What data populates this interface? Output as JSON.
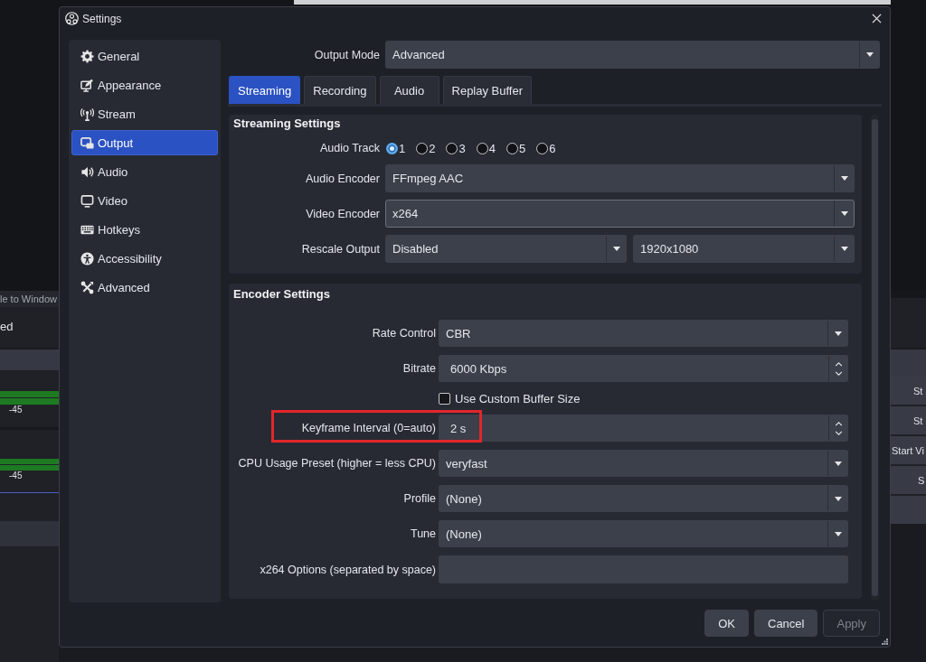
{
  "background_window": {
    "dock_title": "le to Window",
    "panel_text": "ed",
    "meter_labels": [
      "-45",
      "-45"
    ],
    "control_buttons": [
      "St",
      "St",
      "Start Vi",
      "S"
    ]
  },
  "dialog": {
    "title": "Settings",
    "sidebar": {
      "items": [
        {
          "label": "General",
          "selected": false
        },
        {
          "label": "Appearance",
          "selected": false
        },
        {
          "label": "Stream",
          "selected": false
        },
        {
          "label": "Output",
          "selected": true
        },
        {
          "label": "Audio",
          "selected": false
        },
        {
          "label": "Video",
          "selected": false
        },
        {
          "label": "Hotkeys",
          "selected": false
        },
        {
          "label": "Accessibility",
          "selected": false
        },
        {
          "label": "Advanced",
          "selected": false
        }
      ]
    },
    "output_mode": {
      "label": "Output Mode",
      "value": "Advanced"
    },
    "tabs": [
      {
        "label": "Streaming",
        "selected": true
      },
      {
        "label": "Recording",
        "selected": false
      },
      {
        "label": "Audio",
        "selected": false
      },
      {
        "label": "Replay Buffer",
        "selected": false
      }
    ],
    "streaming_settings": {
      "title": "Streaming Settings",
      "rows": [
        {
          "kind": "radios",
          "label": "Audio Track",
          "options": [
            {
              "label": "1",
              "selected": true
            },
            {
              "label": "2",
              "selected": false
            },
            {
              "label": "3",
              "selected": false
            },
            {
              "label": "4",
              "selected": false
            },
            {
              "label": "5",
              "selected": false
            },
            {
              "label": "6",
              "selected": false
            }
          ]
        },
        {
          "kind": "combo",
          "label": "Audio Encoder",
          "value": "FFmpeg AAC",
          "focused": false
        },
        {
          "kind": "combo",
          "label": "Video Encoder",
          "value": "x264",
          "focused": true
        },
        {
          "kind": "combo_pair",
          "label": "Rescale Output",
          "values": [
            "Disabled",
            "1920x1080"
          ],
          "focused": false
        }
      ]
    },
    "encoder_settings": {
      "title": "Encoder Settings",
      "rows": [
        {
          "kind": "combo",
          "label": "Rate Control",
          "value": "CBR",
          "highlighted": false
        },
        {
          "kind": "spin",
          "label": "Bitrate",
          "value": "6000 Kbps",
          "highlighted": false
        },
        {
          "kind": "checkbox",
          "label": "Use Custom Buffer Size",
          "checked": false,
          "highlighted": false
        },
        {
          "kind": "spin",
          "label": "Keyframe Interval (0=auto)",
          "value": "2 s",
          "highlighted": true
        },
        {
          "kind": "combo",
          "label": "CPU Usage Preset (higher = less CPU)",
          "value": "veryfast",
          "highlighted": false
        },
        {
          "kind": "combo",
          "label": "Profile",
          "value": "(None)",
          "highlighted": false
        },
        {
          "kind": "combo",
          "label": "Tune",
          "value": "(None)",
          "highlighted": false
        },
        {
          "kind": "text",
          "label": "x264 Options (separated by space)",
          "highlighted": false
        }
      ]
    },
    "buttons": [
      {
        "label": "OK",
        "disabled": false
      },
      {
        "label": "Cancel",
        "disabled": false
      },
      {
        "label": "Apply",
        "disabled": true
      }
    ]
  }
}
